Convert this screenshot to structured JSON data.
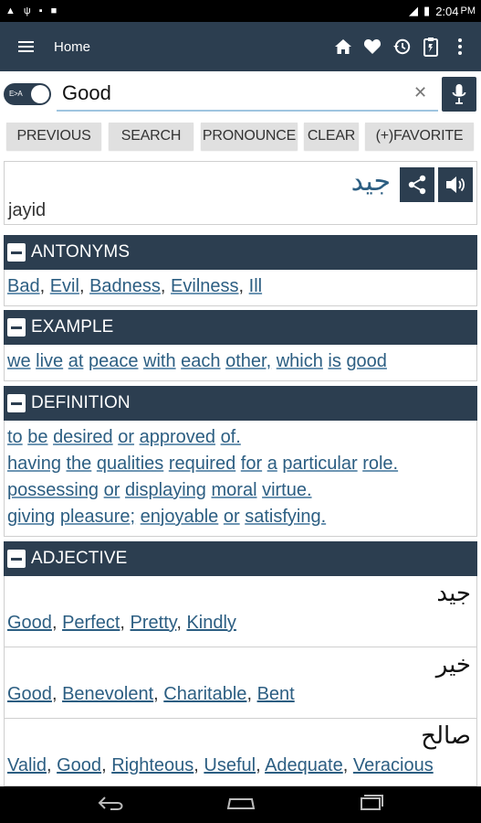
{
  "status_bar": {
    "time": "2:04",
    "ampm": "PM",
    "left_icons": [
      "warning-icon",
      "usb-icon",
      "lock-icon",
      "image-icon"
    ]
  },
  "header": {
    "title": "Home",
    "actions": [
      "home-icon",
      "heart-icon",
      "history-icon",
      "clipboard-icon",
      "more-vertical-icon"
    ]
  },
  "search": {
    "toggle_label": "E>A",
    "value": "Good",
    "placeholder": ""
  },
  "buttons": {
    "previous": "PREVIOUS",
    "search": "SEARCH",
    "pronounce": "PRONOUNCE",
    "clear": "CLEAR",
    "favorite": "(+)FAVORITE"
  },
  "word": {
    "arabic": "جيد",
    "transliteration": "jayid"
  },
  "antonyms": {
    "heading": "ANTONYMS",
    "items": [
      "Bad",
      "Evil",
      "Badness",
      "Evilness",
      "Ill"
    ]
  },
  "example": {
    "heading": "EXAMPLE",
    "words": [
      "we",
      "live",
      "at",
      "peace",
      "with",
      "each",
      "other,",
      "which",
      "is",
      "good"
    ]
  },
  "definition": {
    "heading": "DEFINITION",
    "lines": [
      [
        "to",
        "be",
        "desired",
        "or",
        "approved",
        "of."
      ],
      [
        "having",
        "the",
        "qualities",
        "required",
        "for",
        "a",
        "particular",
        "role."
      ],
      [
        "possessing",
        "or",
        "displaying",
        "moral",
        "virtue."
      ],
      [
        "giving",
        "pleasure;",
        "enjoyable",
        "or",
        "satisfying."
      ]
    ]
  },
  "adjective": {
    "heading": "ADJECTIVE",
    "entries": [
      {
        "arabic": "جيد",
        "synonyms": [
          "Good",
          "Perfect",
          "Pretty",
          "Kindly"
        ]
      },
      {
        "arabic": "خير",
        "synonyms": [
          "Good",
          "Benevolent",
          "Charitable",
          "Bent"
        ]
      },
      {
        "arabic": "صالح",
        "synonyms": [
          "Valid",
          "Good",
          "Righteous",
          "Useful",
          "Adequate",
          "Veracious"
        ]
      }
    ]
  },
  "nav": [
    "back-icon",
    "home-nav-icon",
    "recents-icon"
  ],
  "colors": {
    "primary": "#2c3e50",
    "link": "#2c5e82",
    "button_bg": "#e0e0e0"
  }
}
